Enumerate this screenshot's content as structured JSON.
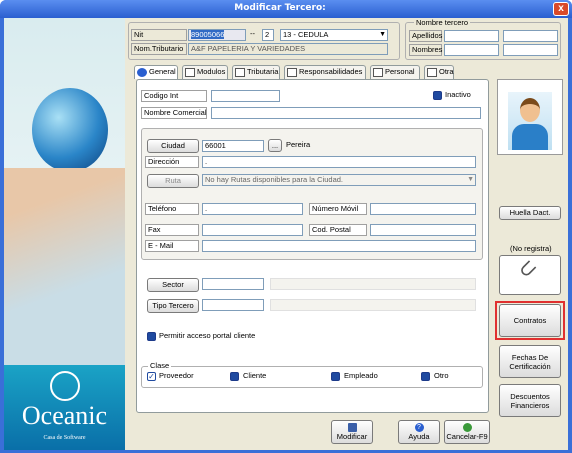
{
  "window": {
    "title": "Modificar Tercero:",
    "close_label": "x"
  },
  "header": {
    "nit_label": "Nit",
    "nit_value": "89005066",
    "dash": "--",
    "dv_value": "2",
    "doc_type": "13 - CEDULA",
    "nom_tributario_label": "Nom.Tributario",
    "nom_tributario_value": "A&F PAPELERIA Y VARIEDADES",
    "nombre_group_label": "Nombre tercero",
    "apellidos_label": "Apellidos",
    "nombres_label": "Nombres"
  },
  "tabs": [
    "General",
    "Modulos",
    "Tributaria",
    "Responsabilidades",
    "Personal",
    "Otra"
  ],
  "general": {
    "codigo_label": "Codigo Int",
    "inactivo_label": "Inactivo",
    "nombre_comercial_label": "Nombre Comercial",
    "ciudad_button": "Ciudad",
    "ciudad_code": "66001",
    "ellipsis": "...",
    "ciudad_name": "Pereira",
    "direccion_label": "Dirección",
    "direccion_value": ".",
    "ruta_button": "Ruta",
    "ruta_value": "No hay Rutas disponibles para la Ciudad.",
    "telefono_label": "Teléfono",
    "telefono_value": ".",
    "movil_label": "Número Móvil",
    "fax_label": "Fax",
    "postal_label": "Cod. Postal",
    "email_label": "E - Mail",
    "sector_button": "Sector",
    "tipo_button": "Tipo Tercero",
    "portal_label": "Permitir acceso portal cliente",
    "clase_label": "Clase",
    "clase_options": [
      "Proveedor",
      "Cliente",
      "Empleado",
      "Otro"
    ]
  },
  "sidebar": {
    "huella_button": "Huella Dact.",
    "no_registra": "(No registra)",
    "contratos_button": "Contratos",
    "fechas_button": "Fechas De Certificación",
    "descuentos_button": "Descuentos Financieros"
  },
  "footer": {
    "modificar": "Modificar",
    "ayuda": "Ayuda",
    "cancelar": "Cancelar-F9"
  },
  "brand": {
    "name": "Oceanic",
    "tagline": "Casa de Software"
  },
  "colors": {
    "highlight": "#e03030",
    "accent": "#1f4aa0"
  }
}
